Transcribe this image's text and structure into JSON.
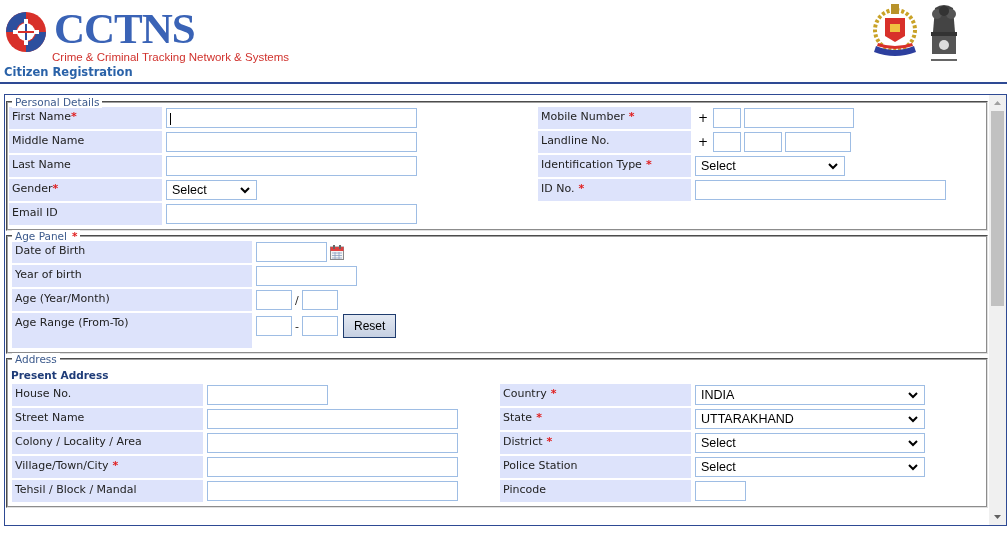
{
  "header": {
    "logo_text": "CCTNS",
    "logo_subtitle": "Crime & Criminal Tracking Network & Systems",
    "page_title": "Citizen Registration"
  },
  "sections": [
    {
      "legend": "Personal Details",
      "columns": [
        [
          {
            "label": "First Name",
            "required_mark": "*",
            "kind": "text",
            "focused": true
          },
          {
            "label": "Middle Name",
            "kind": "text"
          },
          {
            "label": "Last Name",
            "kind": "text"
          },
          {
            "label": "Gender",
            "required_mark": "*",
            "kind": "select",
            "value": "Select"
          },
          {
            "label": "Email ID",
            "kind": "text"
          }
        ],
        [
          {
            "label": "Mobile Number",
            "required_mark": "*",
            "kind": "phone",
            "prefix": "+"
          },
          {
            "label": "Landline No.",
            "kind": "phone",
            "prefix": "+"
          },
          {
            "label": "Identification Type",
            "required_mark": "*",
            "kind": "select",
            "value": "Select"
          },
          {
            "label": "ID No.",
            "required_mark": "*",
            "kind": "text"
          }
        ]
      ]
    },
    {
      "legend": "Age Panel",
      "required_mark": "*",
      "columns": [
        [
          {
            "label": "Date of Birth",
            "kind": "date"
          },
          {
            "label": "Year of birth",
            "kind": "text"
          },
          {
            "label": "Age (Year/Month)",
            "kind": "pair",
            "separator": "/"
          },
          {
            "label": "Age Range (From-To)",
            "kind": "range",
            "separator": "-",
            "button": "Reset"
          }
        ]
      ]
    },
    {
      "legend": "Address",
      "subheading": "Present Address",
      "columns": [
        [
          {
            "label": "House No.",
            "kind": "text"
          },
          {
            "label": "Street Name",
            "kind": "text"
          },
          {
            "label": "Colony / Locality / Area",
            "kind": "text"
          },
          {
            "label": "Village/Town/City",
            "required_mark": "*",
            "kind": "text"
          },
          {
            "label": "Tehsil / Block / Mandal",
            "kind": "text"
          }
        ],
        [
          {
            "label": "Country",
            "required_mark": "*",
            "kind": "select",
            "value": "INDIA"
          },
          {
            "label": "State",
            "required_mark": "*",
            "kind": "select",
            "value": "UTTARAKHAND"
          },
          {
            "label": "District",
            "required_mark": "*",
            "kind": "select",
            "value": "Select"
          },
          {
            "label": "Police Station",
            "kind": "select",
            "value": "Select"
          },
          {
            "label": "Pincode",
            "kind": "text"
          }
        ]
      ]
    }
  ]
}
